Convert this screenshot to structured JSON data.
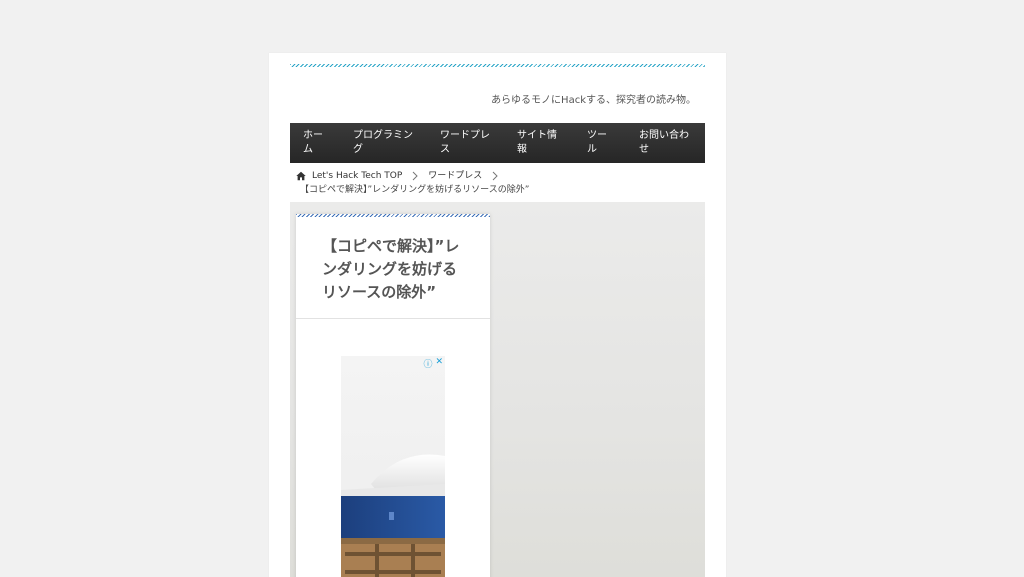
{
  "site": {
    "tagline": "あらゆるモノにHackする、探究者の読み物。"
  },
  "nav": {
    "items": [
      {
        "line1": "ホー",
        "line2": "ム"
      },
      {
        "line1": "プログラミン",
        "line2": "グ"
      },
      {
        "line1": "ワードプレ",
        "line2": "ス"
      },
      {
        "line1": "サイト情",
        "line2": "報"
      },
      {
        "line1": "ツー",
        "line2": "ル"
      },
      {
        "line1": "お問い合わ",
        "line2": "せ"
      }
    ]
  },
  "breadcrumb": {
    "home": "Let's Hack Tech TOP",
    "category": "ワードプレス",
    "current": "【コピペで解決】”レンダリングを妨げるリソースの除外”"
  },
  "article": {
    "title": "【コピペで解決】”レンダリングを妨げるリソースの除外”"
  },
  "ad": {
    "info_icon": "info-icon",
    "close_icon": "close-icon",
    "info_glyph": "ⓘ",
    "close_glyph": "✕"
  },
  "colors": {
    "accent_stripe": "#2aa5c7",
    "card_stripe": "#3c6fb8",
    "nav_bg": "#2f2f2f",
    "ad_icon": "#1a9fd6"
  }
}
